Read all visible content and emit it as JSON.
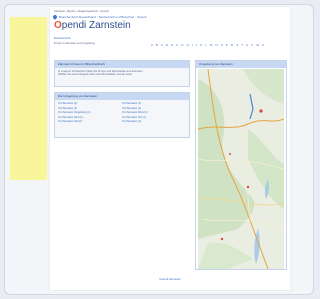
{
  "breadcrumb": "Startseite › Bayern › Regierungsbezirk › Opendi",
  "logo_text": "Branchenbuch Deutschland · Telefonbuch und Branchen · Opendi",
  "title_prefix": "O",
  "title_rest": "pendi Zarnstein",
  "subheading": "Branchenbuch",
  "subline": "Firmen in Zarnstein und Umgebung",
  "alphabet": "A B C D E F G H I J K L M N O P R S T U V W Z",
  "box1": {
    "heading": "Zarnstein Firmen im Branchenbuch",
    "text1": "In unserem Verzeichnis finden Sie Firmen und Dienstleister aus Zarnstein.",
    "text2": "Wählen Sie eine Kategorie oder einen Buchstaben aus der Liste."
  },
  "box2": {
    "heading": "Die Umgebung von Zarnstein",
    "left": [
      "Ort Zarnstein (1)",
      "Ort Zarnstein (1)",
      "Ort Zarnstein Umgebung (1)",
      "Ort Zarnstein Nord (1)",
      "Ort Zarnstein Süd (1)"
    ],
    "right": [
      "Ort Zarnstein (1)",
      "Ort Zarnstein (1)",
      "Ort Zarnstein West (1)",
      "Ort Zarnstein Ost (1)",
      "Ort Zarnstein (1)"
    ]
  },
  "map": {
    "heading": "Umgebung von Zarnstein"
  },
  "footer": "Opendi Zarnstein",
  "colors": {
    "accent": "#3a70c0",
    "title": "#2a4f8f",
    "logo_o": "#e0553a",
    "yellow": "#f9f59a",
    "box_head": "#c7d8f3"
  }
}
